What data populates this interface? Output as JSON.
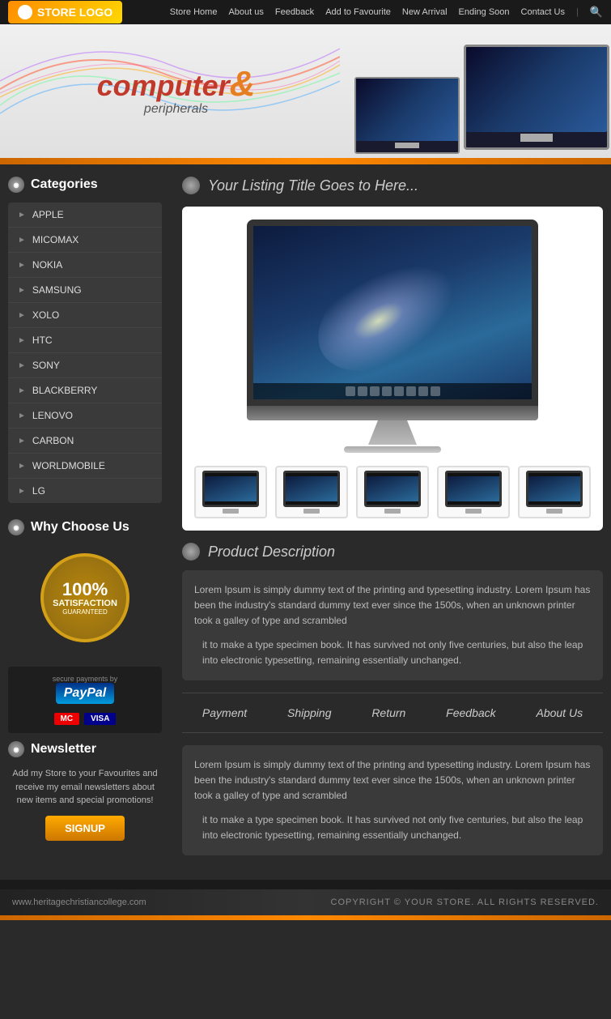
{
  "nav": {
    "logo": "STORE LOGO",
    "links": [
      "Store Home",
      "About us",
      "Feedback",
      "Add to Favourite",
      "New Arrival",
      "Ending Soon",
      "Contact Us"
    ]
  },
  "hero": {
    "line1": "computer",
    "amp": "&",
    "line2": "peripherals"
  },
  "sidebar": {
    "categories_title": "Categories",
    "categories": [
      "APPLE",
      "MICOMAX",
      "NOKIA",
      "SAMSUNG",
      "XOLO",
      "HTC",
      "SONY",
      "BLACKBERRY",
      "LENOVO",
      "CARBON",
      "WORLDMOBILE",
      "LG"
    ],
    "why_choose_title": "Why Choose Us",
    "satisfaction_pct": "100%",
    "satisfaction_label": "SATISFACTION",
    "satisfaction_sub": "GUARANTEED",
    "paypal_label": "PayPal",
    "secure_text": "secure payments by",
    "newsletter_title": "Newsletter",
    "newsletter_body": "Add my Store to your Favourites and receive my email newsletters about new items and special promotions!",
    "signup_label": "SIGNUP"
  },
  "content": {
    "listing_title": "Your Listing Title Goes to Here...",
    "product_desc_title": "Product Description",
    "desc_para1": "Lorem Ipsum is simply dummy text of the printing and typesetting industry. Lorem Ipsum has been the industry's standard dummy text ever since the 1500s, when an unknown printer took a galley of type and scrambled",
    "desc_para2": "it to make a type specimen book. It has survived not only five centuries, but also the leap into electronic typesetting, remaining essentially unchanged.",
    "tabs": [
      "Payment",
      "Shipping",
      "Return",
      "Feedback",
      "About Us"
    ],
    "desc2_para1": "Lorem Ipsum is simply dummy text of the printing and typesetting industry. Lorem Ipsum has been the industry's standard dummy text ever since the 1500s, when an unknown printer took a galley of type and scrambled",
    "desc2_para2": "it to make a type specimen book. It has survived not only five centuries, but also the leap into electronic typesetting, remaining essentially unchanged.",
    "thumbnails_count": 5
  },
  "footer": {
    "url": "www.heritagechristiancollege.com",
    "copyright": "COPYRIGHT © YOUR STORE. ALL RIGHTS RESERVED."
  }
}
